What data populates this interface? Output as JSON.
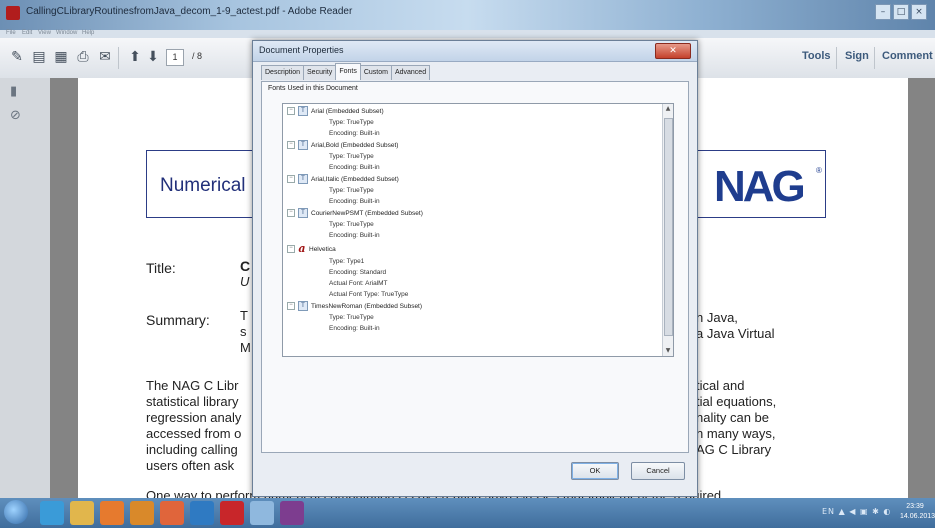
{
  "window": {
    "title": "CallingCLibraryRoutinesfromJava_decom_1-9_actest.pdf - Adobe Reader",
    "controls": [
      "–",
      "□",
      "×"
    ]
  },
  "menubar": [
    "File",
    "Edit",
    "View",
    "Window",
    "Help"
  ],
  "toolbar": {
    "page_current": "1",
    "page_total": "/ 8",
    "tools_label": "Tools",
    "sign_label": "Sign",
    "comment_label": "Comment"
  },
  "document": {
    "banner_title": "Numerical",
    "logo_text": "NAG",
    "logo_mark": "®",
    "title_label": "Title:",
    "title_partial": "C",
    "title_partial_2": "U",
    "summary_label": "Summary:",
    "summary_left": [
      "T",
      "s",
      "M"
    ],
    "summary_right": [
      "n Java,",
      "a Java Virtual"
    ],
    "body_left": [
      "The NAG C Libr",
      "statistical library",
      "regression analy",
      "accessed from o",
      "including calling",
      "users often ask"
    ],
    "body_right": [
      "tical and",
      "tial equations,",
      "nality can be",
      "n many ways,",
      "AG C Library",
      ""
    ],
    "bottom_line": "One way to perform numerical computations is by creating Java classes that implement the required"
  },
  "dialog": {
    "title": "Document Properties",
    "close": "✕",
    "tabs": [
      "Description",
      "Security",
      "Fonts",
      "Custom",
      "Advanced"
    ],
    "active_tab": "Fonts",
    "group_label": "Fonts Used in this Document",
    "fonts": [
      {
        "name": "Arial (Embedded Subset)",
        "icon": "truetype-font-icon",
        "props": [
          "Type: TrueType",
          "Encoding: Built-in"
        ]
      },
      {
        "name": "Arial,Bold (Embedded Subset)",
        "icon": "truetype-font-icon",
        "props": [
          "Type: TrueType",
          "Encoding: Built-in"
        ]
      },
      {
        "name": "Arial,Italic (Embedded Subset)",
        "icon": "truetype-font-icon",
        "props": [
          "Type: TrueType",
          "Encoding: Built-in"
        ]
      },
      {
        "name": "CourierNewPSMT (Embedded Subset)",
        "icon": "truetype-font-icon",
        "props": [
          "Type: TrueType",
          "Encoding: Built-in"
        ]
      },
      {
        "name": "Helvetica",
        "icon": "type1-font-icon",
        "props": [
          "Type: Type1",
          "Encoding: Standard",
          "Actual Font: ArialMT",
          "Actual Font Type: TrueType"
        ]
      },
      {
        "name": "TimesNewRoman (Embedded Subset)",
        "icon": "truetype-font-icon",
        "props": [
          "Type: TrueType",
          "Encoding: Built-in"
        ]
      }
    ],
    "ok_label": "OK",
    "cancel_label": "Cancel"
  },
  "taskbar": {
    "tray_text": "EN ▲ ◀ ▣ ✱ ◐",
    "time": "23:39",
    "date": "14.06.2013"
  },
  "colors": {
    "nag_blue": "#1f3d8e",
    "dialog_bg": "#e9edf3",
    "taskbar": "#4a7bab"
  }
}
